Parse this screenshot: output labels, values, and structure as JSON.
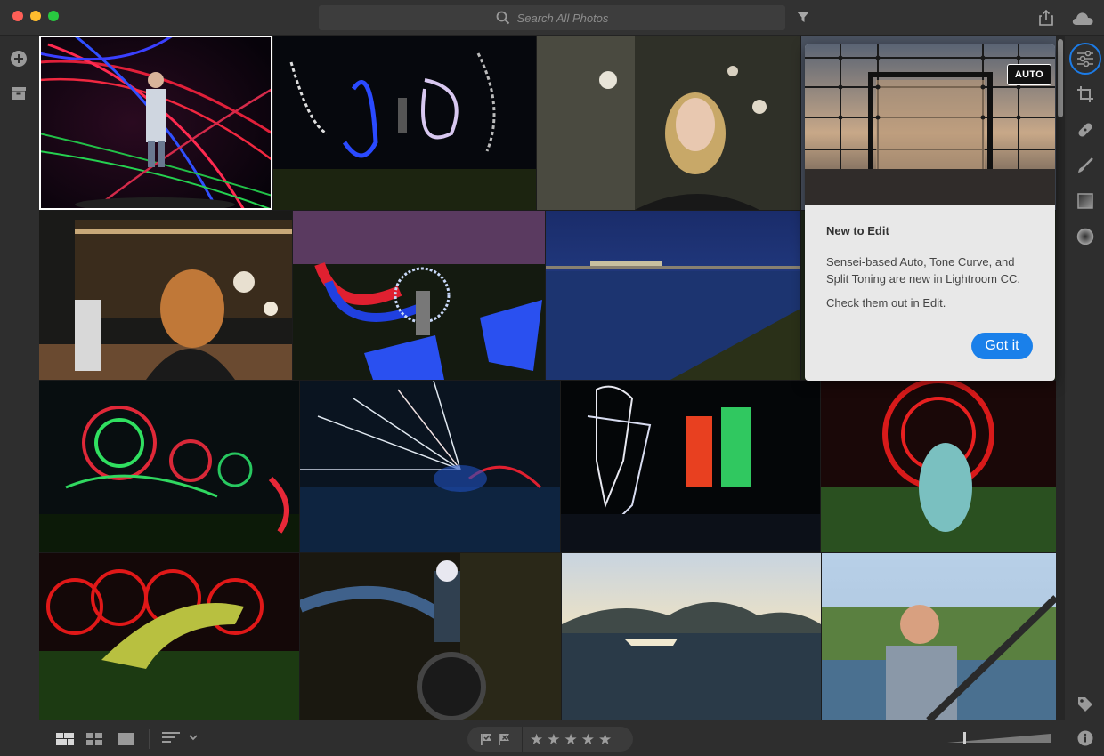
{
  "window": {
    "controls": [
      "close",
      "minimize",
      "maximize"
    ]
  },
  "search": {
    "placeholder": "Search All Photos",
    "icon": "search-icon"
  },
  "toolbar": {
    "filter_icon": "filter-icon",
    "share_icon": "share-icon",
    "cloud_icon": "cloud-sync-icon"
  },
  "left_rail": {
    "items": [
      "add-photos-icon",
      "archive-icon"
    ]
  },
  "right_rail": {
    "active": "edit",
    "tools": [
      "edit-sliders-icon",
      "crop-icon",
      "healing-icon",
      "brush-icon",
      "linear-gradient-icon",
      "radial-gradient-icon",
      "keyword-tag-icon",
      "info-icon"
    ]
  },
  "photos": [
    {
      "subject": "man with laser light lines",
      "selected": true
    },
    {
      "subject": "light painting figures at night"
    },
    {
      "subject": "portrait of blonde woman"
    },
    {
      "subject": "window with grid view"
    },
    {
      "subject": "woman at bar"
    },
    {
      "subject": "light painted guitarist"
    },
    {
      "subject": "night river stadium"
    },
    {
      "subject": "green red light orbs"
    },
    {
      "subject": "light streaks in field"
    },
    {
      "subject": "light painted robot figures"
    },
    {
      "subject": "dinosaur with red rings"
    },
    {
      "subject": "lizard with red light loops"
    },
    {
      "subject": "skull rider motorbike"
    },
    {
      "subject": "boat on lake"
    },
    {
      "subject": "man paddling kayak"
    }
  ],
  "popover": {
    "badge": "AUTO",
    "title": "New to Edit",
    "body": "Sensei-based Auto, Tone Curve, and Split Toning are new in Lightroom CC.",
    "body2": "Check them out in Edit.",
    "button": "Got it"
  },
  "bottombar": {
    "views": [
      "photo-grid-icon",
      "square-grid-icon",
      "single-view-icon"
    ],
    "sort_icon": "sort-icon",
    "rating": 0,
    "stars_total": 5
  },
  "colors": {
    "accent": "#1a80ea",
    "selected_outline": "#ffffff"
  }
}
